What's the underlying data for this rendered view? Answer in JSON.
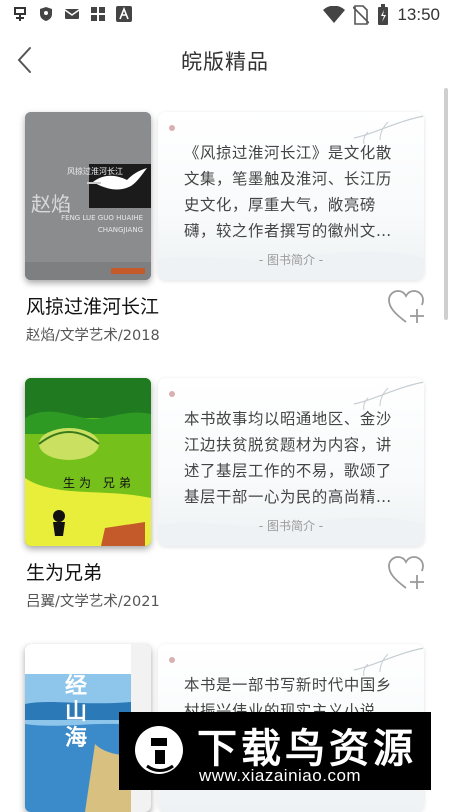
{
  "status_bar": {
    "time": "13:50",
    "icons_left": [
      "app-logo-icon",
      "shield-icon",
      "mail-icon",
      "grid-app-icon",
      "a-app-icon"
    ],
    "icons_right": [
      "wifi-icon",
      "no-sim-icon",
      "battery-charging-icon"
    ]
  },
  "header": {
    "title": "皖版精品",
    "back_icon": "chevron-left-icon"
  },
  "summary_label": "- 图书简介 -",
  "books": [
    {
      "title": "风掠过淮河长江",
      "meta": "赵焰/文学艺术/2018",
      "summary": "《风掠过淮河长江》是文化散文集，笔墨触及淮河、长江历史文化，厚重大气，敞亮磅礴，较之作者撰写的徽州文化散文，是…",
      "cover": {
        "author_mark": "赵焰",
        "title_mark": "风掠过淮河长江",
        "pinyin": "FENG LUE GUO HUAIHE CHANGJIANG",
        "bg_color": "#8e8f91"
      },
      "favorited": false
    },
    {
      "title": "生为兄弟",
      "meta": "吕翼/文学艺术/2021",
      "summary": "本书故事均以昭通地区、金沙江边扶贫脱贫题材为内容，讲述了基层工作的不易，歌颂了基层干部一心为民的高尚精神。体现…",
      "cover": {
        "title_mark": "生为 兄弟",
        "bg_color": "#7ac41a"
      },
      "favorited": false
    },
    {
      "title": "",
      "meta": "",
      "summary": "本书是一部书写新时代中国乡村振兴伟业的现实主义小说，诠释…",
      "cover": {
        "title_mark": "经山海",
        "bg_color": "#3f8fd0"
      },
      "favorited": false
    }
  ],
  "watermark": {
    "title": "下载鸟资源",
    "url": "www.xiazainiao.com"
  },
  "colors": {
    "background": "#ffffff",
    "text_primary": "#111111",
    "text_secondary": "#555555",
    "favorite_outline": "#9a9a9a"
  }
}
